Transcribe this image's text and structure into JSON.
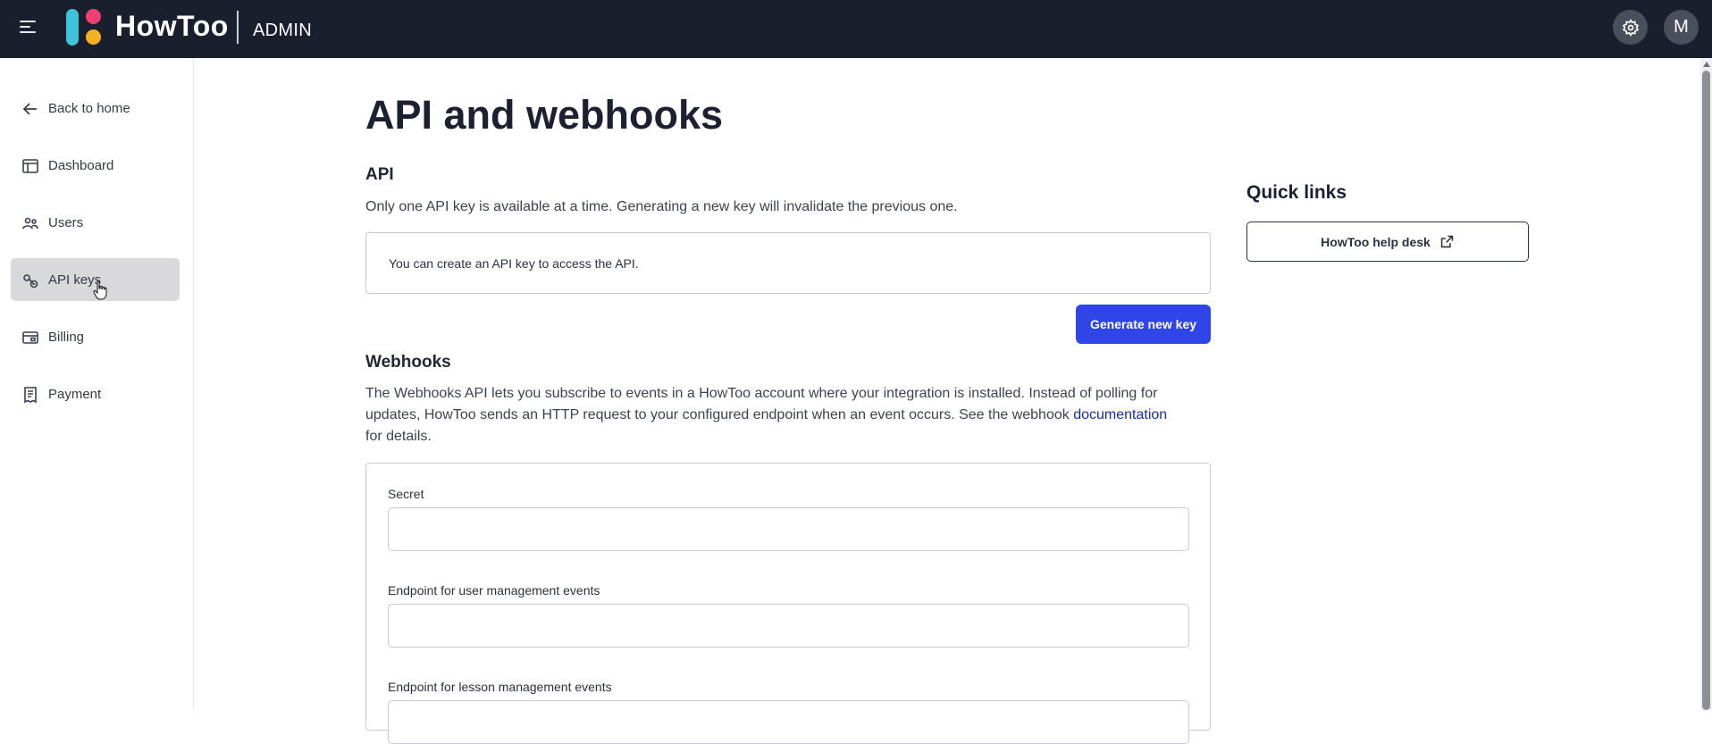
{
  "header": {
    "brand": "HowToo",
    "section": "ADMIN",
    "avatar_initial": "M",
    "brand_colors": {
      "bar": "#3fc3d9",
      "pink": "#ee3f72",
      "yellow": "#f4b223"
    }
  },
  "sidebar": {
    "items": [
      {
        "label": "Back to home",
        "icon": "arrow-left-icon"
      },
      {
        "label": "Dashboard",
        "icon": "dashboard-icon"
      },
      {
        "label": "Users",
        "icon": "users-icon"
      },
      {
        "label": "API keys",
        "icon": "key-icon",
        "active": true
      },
      {
        "label": "Billing",
        "icon": "billing-icon"
      },
      {
        "label": "Payment",
        "icon": "receipt-icon"
      }
    ]
  },
  "main": {
    "title": "API and webhooks",
    "api": {
      "heading": "API",
      "description": "Only one API key is available at a time. Generating a new key will invalidate the previous one.",
      "info": "You can create an API key to access the API.",
      "generate_button": "Generate new key"
    },
    "webhooks": {
      "heading": "Webhooks",
      "description_line1": "The Webhooks API lets you subscribe to events in a HowToo account where your integration is installed. Instead of polling for",
      "description_line2_before_link": "updates, HowToo sends an HTTP request to your configured endpoint when an event occurs. See the webhook ",
      "link_text": "documentation",
      "description_line3": "for details.",
      "fields": [
        {
          "label": "Secret",
          "value": ""
        },
        {
          "label": "Endpoint for user management events",
          "value": ""
        },
        {
          "label": "Endpoint for lesson management events",
          "value": ""
        }
      ]
    }
  },
  "quick_links": {
    "title": "Quick links",
    "help_desk": "HowToo help desk"
  },
  "colors": {
    "topbar": "#1a1f2e",
    "primary": "#2f45e8",
    "link": "#1b2e9b",
    "active_item": "#d9d9dc"
  }
}
